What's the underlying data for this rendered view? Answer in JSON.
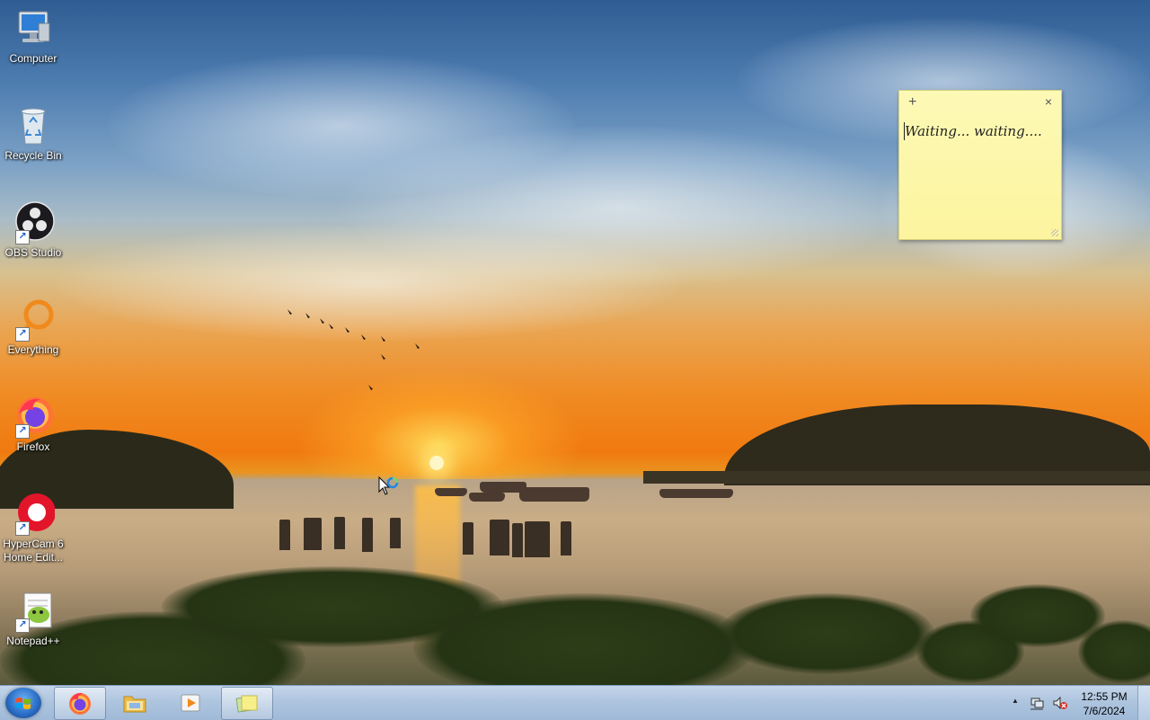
{
  "desktop": {
    "icons": [
      {
        "label": "Computer",
        "icon": "computer-icon"
      },
      {
        "label": "Recycle Bin",
        "icon": "recycle-bin-icon"
      },
      {
        "label": "OBS Studio",
        "icon": "obs-studio-icon"
      },
      {
        "label": "Everything",
        "icon": "everything-icon"
      },
      {
        "label": "Firefox",
        "icon": "firefox-icon"
      },
      {
        "label": "HyperCam 6 Home Edit...",
        "icon": "hypercam-icon"
      },
      {
        "label": "Notepad++",
        "icon": "notepad-plus-plus-icon"
      }
    ]
  },
  "sticky_note": {
    "add": "+",
    "close": "×",
    "text": "Waiting... waiting...."
  },
  "taskbar": {
    "start": "start-orb",
    "pinned": [
      {
        "app": "Firefox",
        "icon": "firefox-icon",
        "active": true
      },
      {
        "app": "Windows Explorer",
        "icon": "folder-icon",
        "active": false
      },
      {
        "app": "Windows Media Player",
        "icon": "media-player-icon",
        "active": false
      },
      {
        "app": "Sticky Notes",
        "icon": "sticky-notes-icon",
        "active": true
      }
    ],
    "tray": {
      "show_hidden": "▲",
      "icons": [
        "network-icon",
        "volume-muted-icon"
      ]
    },
    "clock": {
      "time": "12:55 PM",
      "date": "7/6/2024"
    }
  },
  "colors": {
    "taskbar": "#aec5df",
    "sticky": "#fcf49e",
    "accent": "#2b6fc8"
  }
}
